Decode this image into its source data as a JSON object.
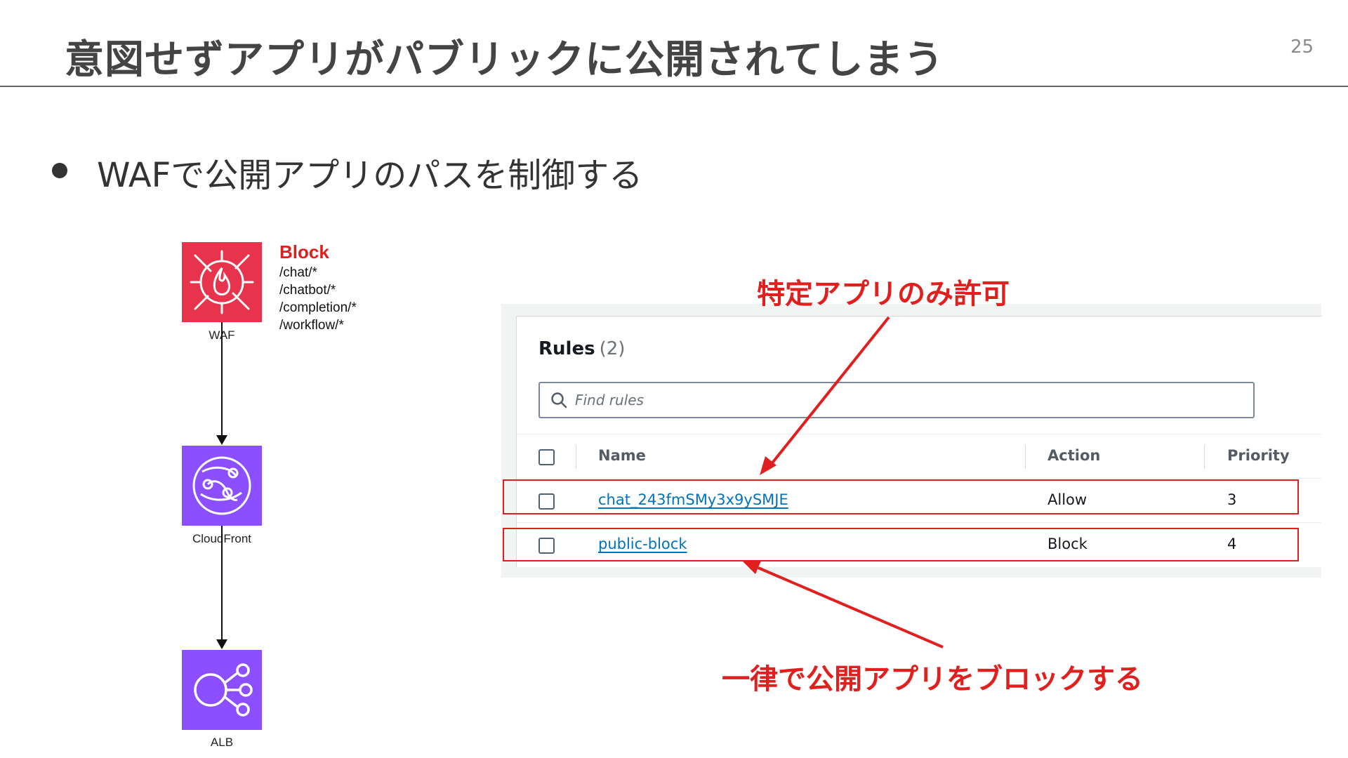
{
  "slide": {
    "title": "意図せずアプリがパブリックに公開されてしまう",
    "page_number": "25",
    "bullet": "WAFで公開アプリのパスを制御する"
  },
  "diagram": {
    "waf_label": "WAF",
    "cloudfront_label": "CloudFront",
    "alb_label": "ALB",
    "block_title": "Block",
    "block_paths": [
      "/chat/*",
      "/chatbot/*",
      "/completion/*",
      "/workflow/*"
    ]
  },
  "console": {
    "heading": "Rules",
    "count": "(2)",
    "search_placeholder": "Find rules",
    "columns": {
      "name": "Name",
      "action": "Action",
      "priority": "Priority"
    },
    "rows": [
      {
        "name": "chat_243fmSMy3x9ySMJE",
        "action": "Allow",
        "priority": "3"
      },
      {
        "name": "public-block",
        "action": "Block",
        "priority": "4"
      }
    ]
  },
  "annotations": {
    "allow_note": "特定アプリのみ許可",
    "block_note": "一律で公開アプリをブロックする"
  },
  "colors": {
    "accent_red": "#e0201e",
    "waf_red": "#e7344c",
    "service_purple": "#8c4fff",
    "link_blue": "#0073bb"
  }
}
